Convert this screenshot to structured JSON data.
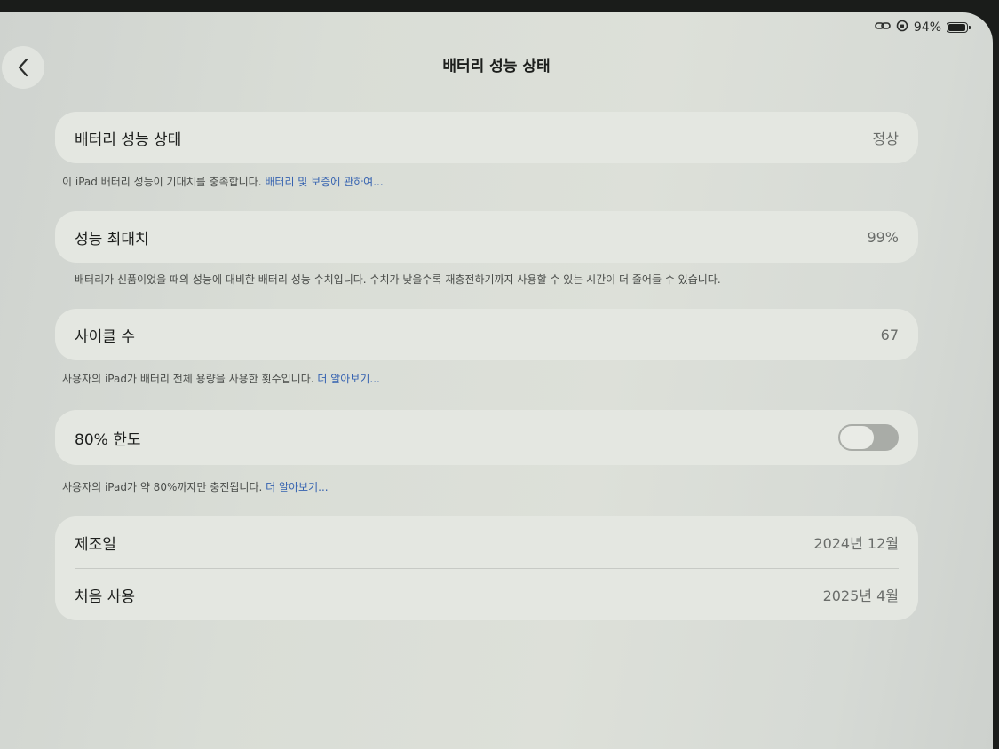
{
  "status_bar": {
    "battery_percent": "94%",
    "battery_level": 0.94
  },
  "header": {
    "title": "배터리 성능 상태"
  },
  "health": {
    "label": "배터리 성능 상태",
    "value": "정상",
    "footer_text": "이 iPad 배터리 성능이 기대치를 충족합니다. ",
    "footer_link": "배터리 및 보증에 관하여..."
  },
  "max_capacity": {
    "label": "성능 최대치",
    "value": "99%",
    "footer_text": "배터리가 신품이었을 때의 성능에 대비한 배터리 성능 수치입니다. 수치가 낮을수록 재충전하기까지 사용할 수 있는 시간이 더 줄어들 수 있습니다."
  },
  "cycle_count": {
    "label": "사이클 수",
    "value": "67",
    "footer_text": "사용자의 iPad가 배터리 전체 용량을 사용한 횟수입니다. ",
    "footer_link": "더 알아보기..."
  },
  "limit_80": {
    "label": "80% 한도",
    "enabled": false,
    "footer_text": "사용자의 iPad가 약 80%까지만 충전됩니다. ",
    "footer_link": "더 알아보기..."
  },
  "dates": {
    "manufactured_label": "제조일",
    "manufactured_value": "2024년 12월",
    "first_use_label": "처음 사용",
    "first_use_value": "2025년 4월"
  }
}
